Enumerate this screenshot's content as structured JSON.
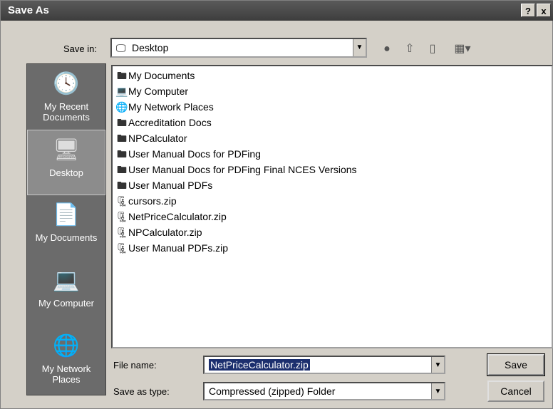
{
  "window": {
    "title": "Save As",
    "help_label": "?",
    "close_label": "x"
  },
  "toolbar": {
    "save_in_label": "Save in:",
    "save_in_value": "Desktop",
    "icons": [
      "back-icon",
      "up-folder-icon",
      "new-folder-icon",
      "views-icon"
    ]
  },
  "places": [
    {
      "label": "My Recent Documents",
      "icon": "recent-documents-icon",
      "selected": false
    },
    {
      "label": "Desktop",
      "icon": "desktop-icon",
      "selected": true
    },
    {
      "label": "My Documents",
      "icon": "my-documents-icon",
      "selected": false
    },
    {
      "label": "My Computer",
      "icon": "my-computer-icon",
      "selected": false
    },
    {
      "label": "My Network Places",
      "icon": "network-places-icon",
      "selected": false
    }
  ],
  "files": [
    {
      "name": "My Documents",
      "icon": "folder-icon"
    },
    {
      "name": "My Computer",
      "icon": "computer-icon"
    },
    {
      "name": "My Network Places",
      "icon": "network-icon"
    },
    {
      "name": "Accreditation Docs",
      "icon": "folder-icon"
    },
    {
      "name": "NPCalculator",
      "icon": "folder-icon"
    },
    {
      "name": "User Manual Docs for PDFing",
      "icon": "folder-icon"
    },
    {
      "name": "User Manual Docs for PDFing Final NCES Versions",
      "icon": "folder-icon"
    },
    {
      "name": "User Manual PDFs",
      "icon": "folder-icon"
    },
    {
      "name": "cursors.zip",
      "icon": "zip-folder-icon"
    },
    {
      "name": "NetPriceCalculator.zip",
      "icon": "zip-folder-icon"
    },
    {
      "name": "NPCalculator.zip",
      "icon": "zip-folder-icon"
    },
    {
      "name": "User Manual PDFs.zip",
      "icon": "zip-folder-icon"
    }
  ],
  "form": {
    "file_name_label": "File name:",
    "file_name_value": "NetPriceCalculator.zip",
    "save_type_label": "Save as type:",
    "save_type_value": "Compressed (zipped) Folder"
  },
  "buttons": {
    "save": "Save",
    "cancel": "Cancel"
  }
}
